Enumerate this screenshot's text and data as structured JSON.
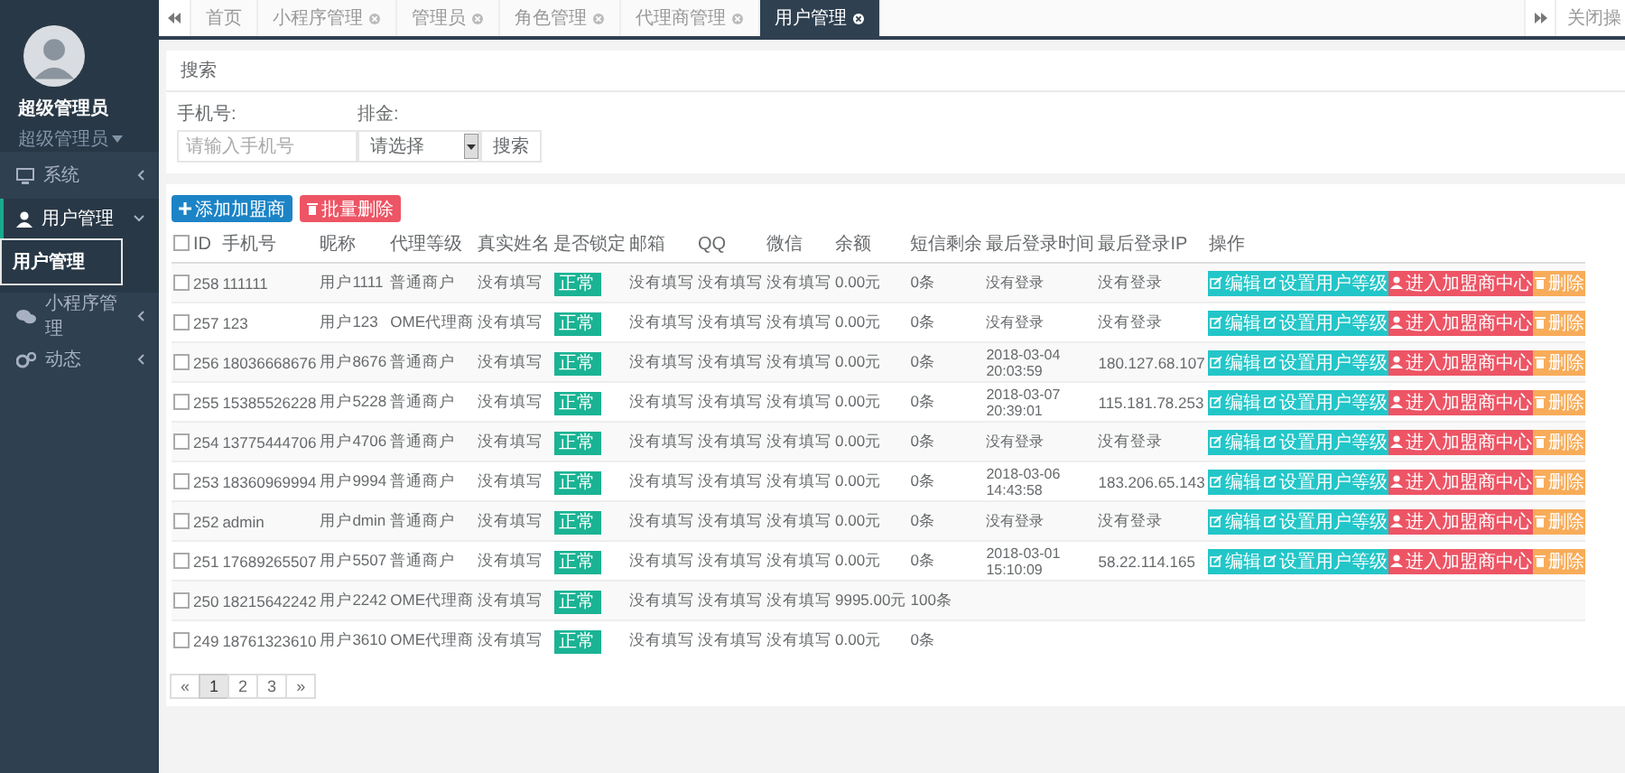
{
  "sidebar": {
    "user_name": "超级管理员",
    "user_role": "超级管理员",
    "menu": [
      {
        "label": "系统",
        "expanded": false
      },
      {
        "label": "用户管理",
        "expanded": true,
        "children": [
          {
            "label": "用户管理",
            "selected": true
          }
        ]
      },
      {
        "label": "小程序管理",
        "expanded": false
      },
      {
        "label": "动态",
        "expanded": false
      }
    ]
  },
  "tab_bar": {
    "tabs": [
      {
        "label": "首页",
        "closable": false,
        "selected": false
      },
      {
        "label": "小程序管理",
        "closable": true,
        "selected": false
      },
      {
        "label": "管理员",
        "closable": true,
        "selected": false
      },
      {
        "label": "角色管理",
        "closable": true,
        "selected": false
      },
      {
        "label": "代理商管理",
        "closable": true,
        "selected": false
      },
      {
        "label": "用户管理",
        "closable": true,
        "selected": true
      }
    ],
    "close_ops_label": "关闭操"
  },
  "search": {
    "title": "搜索",
    "fields": [
      {
        "kind": "input",
        "label": "手机号:",
        "placeholder": "请输入手机号"
      },
      {
        "kind": "select",
        "label": "排金:",
        "value": "请选择"
      }
    ],
    "button": "搜索"
  },
  "table": {
    "buttons": [
      {
        "kind": "primary",
        "label": "添加加盟商"
      },
      {
        "kind": "danger",
        "label": "批量删除"
      }
    ],
    "header_checked": false,
    "columns": [
      "ID",
      "手机号",
      "昵称",
      "代理等级",
      "真实姓名",
      "是否锁定",
      "邮箱",
      "QQ",
      "微信",
      "余额",
      "短信剩余",
      "最后登录时间",
      "最后登录IP",
      "操作"
    ],
    "rows": [
      {
        "checked": false,
        "id": "258",
        "phone": "111111",
        "nickname": "用户1111",
        "level": "普通商户",
        "real_name": "没有填写",
        "status": "正常",
        "email": "没有填写",
        "qq": "没有填写",
        "wechat": "没有填写",
        "balance": "0.00元",
        "sms": "0条",
        "last_login_time": "没有登录",
        "last_login_ip": "没有登录",
        "actions": [
          {
            "kind": "edit",
            "label": "编辑"
          },
          {
            "kind": "level",
            "label": "设置用户等级"
          },
          {
            "kind": "enter",
            "label": "进入加盟商中心"
          },
          {
            "kind": "delete",
            "label": "删除"
          }
        ]
      },
      {
        "checked": false,
        "id": "257",
        "phone": "123",
        "nickname": "用户123",
        "level": "OME代理商",
        "real_name": "没有填写",
        "status": "正常",
        "email": "没有填写",
        "qq": "没有填写",
        "wechat": "没有填写",
        "balance": "0.00元",
        "sms": "0条",
        "last_login_time": "没有登录",
        "last_login_ip": "没有登录",
        "actions": [
          {
            "kind": "edit",
            "label": "编辑"
          },
          {
            "kind": "level",
            "label": "设置用户等级"
          },
          {
            "kind": "enter",
            "label": "进入加盟商中心"
          },
          {
            "kind": "delete",
            "label": "删除"
          }
        ]
      },
      {
        "checked": false,
        "id": "256",
        "phone": "18036668676",
        "nickname": "用户8676",
        "level": "普通商户",
        "real_name": "没有填写",
        "status": "正常",
        "email": "没有填写",
        "qq": "没有填写",
        "wechat": "没有填写",
        "balance": "0.00元",
        "sms": "0条",
        "last_login_time": "2018-03-04 20:03:59",
        "last_login_ip": "180.127.68.107",
        "actions": [
          {
            "kind": "edit",
            "label": "编辑"
          },
          {
            "kind": "level",
            "label": "设置用户等级"
          },
          {
            "kind": "enter",
            "label": "进入加盟商中心"
          },
          {
            "kind": "delete",
            "label": "删除"
          }
        ]
      },
      {
        "checked": false,
        "id": "255",
        "phone": "15385526228",
        "nickname": "用户5228",
        "level": "普通商户",
        "real_name": "没有填写",
        "status": "正常",
        "email": "没有填写",
        "qq": "没有填写",
        "wechat": "没有填写",
        "balance": "0.00元",
        "sms": "0条",
        "last_login_time": "2018-03-07 20:39:01",
        "last_login_ip": "115.181.78.253",
        "actions": [
          {
            "kind": "edit",
            "label": "编辑"
          },
          {
            "kind": "level",
            "label": "设置用户等级"
          },
          {
            "kind": "enter",
            "label": "进入加盟商中心"
          },
          {
            "kind": "delete",
            "label": "删除"
          }
        ]
      },
      {
        "checked": false,
        "id": "254",
        "phone": "13775444706",
        "nickname": "用户4706",
        "level": "普通商户",
        "real_name": "没有填写",
        "status": "正常",
        "email": "没有填写",
        "qq": "没有填写",
        "wechat": "没有填写",
        "balance": "0.00元",
        "sms": "0条",
        "last_login_time": "没有登录",
        "last_login_ip": "没有登录",
        "actions": [
          {
            "kind": "edit",
            "label": "编辑"
          },
          {
            "kind": "level",
            "label": "设置用户等级"
          },
          {
            "kind": "enter",
            "label": "进入加盟商中心"
          },
          {
            "kind": "delete",
            "label": "删除"
          }
        ]
      },
      {
        "checked": false,
        "id": "253",
        "phone": "18360969994",
        "nickname": "用户9994",
        "level": "普通商户",
        "real_name": "没有填写",
        "status": "正常",
        "email": "没有填写",
        "qq": "没有填写",
        "wechat": "没有填写",
        "balance": "0.00元",
        "sms": "0条",
        "last_login_time": "2018-03-06 14:43:58",
        "last_login_ip": "183.206.65.143",
        "actions": [
          {
            "kind": "edit",
            "label": "编辑"
          },
          {
            "kind": "level",
            "label": "设置用户等级"
          },
          {
            "kind": "enter",
            "label": "进入加盟商中心"
          },
          {
            "kind": "delete",
            "label": "删除"
          }
        ]
      },
      {
        "checked": false,
        "id": "252",
        "phone": "admin",
        "nickname": "用户dmin",
        "level": "普通商户",
        "real_name": "没有填写",
        "status": "正常",
        "email": "没有填写",
        "qq": "没有填写",
        "wechat": "没有填写",
        "balance": "0.00元",
        "sms": "0条",
        "last_login_time": "没有登录",
        "last_login_ip": "没有登录",
        "actions": [
          {
            "kind": "edit",
            "label": "编辑"
          },
          {
            "kind": "level",
            "label": "设置用户等级"
          },
          {
            "kind": "enter",
            "label": "进入加盟商中心"
          },
          {
            "kind": "delete",
            "label": "删除"
          }
        ]
      },
      {
        "checked": false,
        "id": "251",
        "phone": "17689265507",
        "nickname": "用户5507",
        "level": "普通商户",
        "real_name": "没有填写",
        "status": "正常",
        "email": "没有填写",
        "qq": "没有填写",
        "wechat": "没有填写",
        "balance": "0.00元",
        "sms": "0条",
        "last_login_time": "2018-03-01 15:10:09",
        "last_login_ip": "58.22.114.165",
        "actions": [
          {
            "kind": "edit",
            "label": "编辑"
          },
          {
            "kind": "level",
            "label": "设置用户等级"
          },
          {
            "kind": "enter",
            "label": "进入加盟商中心"
          },
          {
            "kind": "delete",
            "label": "删除"
          }
        ]
      },
      {
        "checked": false,
        "id": "250",
        "phone": "18215642242",
        "nickname": "用户2242",
        "level": "OME代理商",
        "real_name": "没有填写",
        "status": "正常",
        "email": "没有填写",
        "qq": "没有填写",
        "wechat": "没有填写",
        "balance": "9995.00元",
        "sms": "100条"
      },
      {
        "checked": false,
        "id": "249",
        "phone": "18761323610",
        "nickname": "用户3610",
        "level": "OME代理商",
        "real_name": "没有填写",
        "status": "正常",
        "email": "没有填写",
        "qq": "没有填写",
        "wechat": "没有填写",
        "balance": "0.00元",
        "sms": "0条"
      }
    ],
    "pagination": {
      "prev": "«",
      "next": "»",
      "pages": [
        {
          "label": "1",
          "selected": true
        },
        {
          "label": "2",
          "selected": false
        },
        {
          "label": "3",
          "selected": false
        }
      ]
    }
  }
}
